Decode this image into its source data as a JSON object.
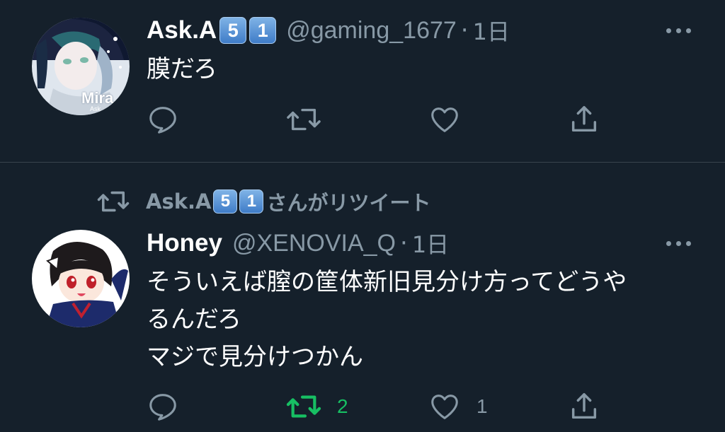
{
  "tweets": [
    {
      "author_name": "Ask.A",
      "badges": [
        "5",
        "1"
      ],
      "handle": "@gaming_1677",
      "separator": "·",
      "time": "1日",
      "text_lines": [
        "膜だろ"
      ],
      "avatar_text": "Mira",
      "avatar_subtext": "Ask",
      "actions": {
        "reply_count": "",
        "retweet_count": "",
        "like_count": ""
      }
    },
    {
      "retweeted_by": {
        "name": "Ask.A",
        "badges": [
          "5",
          "1"
        ],
        "suffix": "さんがリツイート"
      },
      "author_name": "Honey",
      "handle": "@XENOVIA_Q",
      "separator": "·",
      "time": "1日",
      "text_lines": [
        "そういえば膣の筐体新旧見分け方ってどうや",
        "るんだろ",
        "マジで見分けつかん"
      ],
      "actions": {
        "reply_count": "",
        "retweet_count": "2",
        "like_count": "1"
      }
    }
  ],
  "colors": {
    "background": "#15202b",
    "divider": "#38444d",
    "text_primary": "#ffffff",
    "text_secondary": "#8899a6",
    "retweet_active": "#17bf63",
    "badge_blue": "#3f7cc8"
  },
  "icons": {
    "reply": "speech-bubble-icon",
    "retweet": "retweet-arrows-icon",
    "like": "heart-outline-icon",
    "share": "share-upload-icon",
    "more": "ellipsis-icon"
  }
}
